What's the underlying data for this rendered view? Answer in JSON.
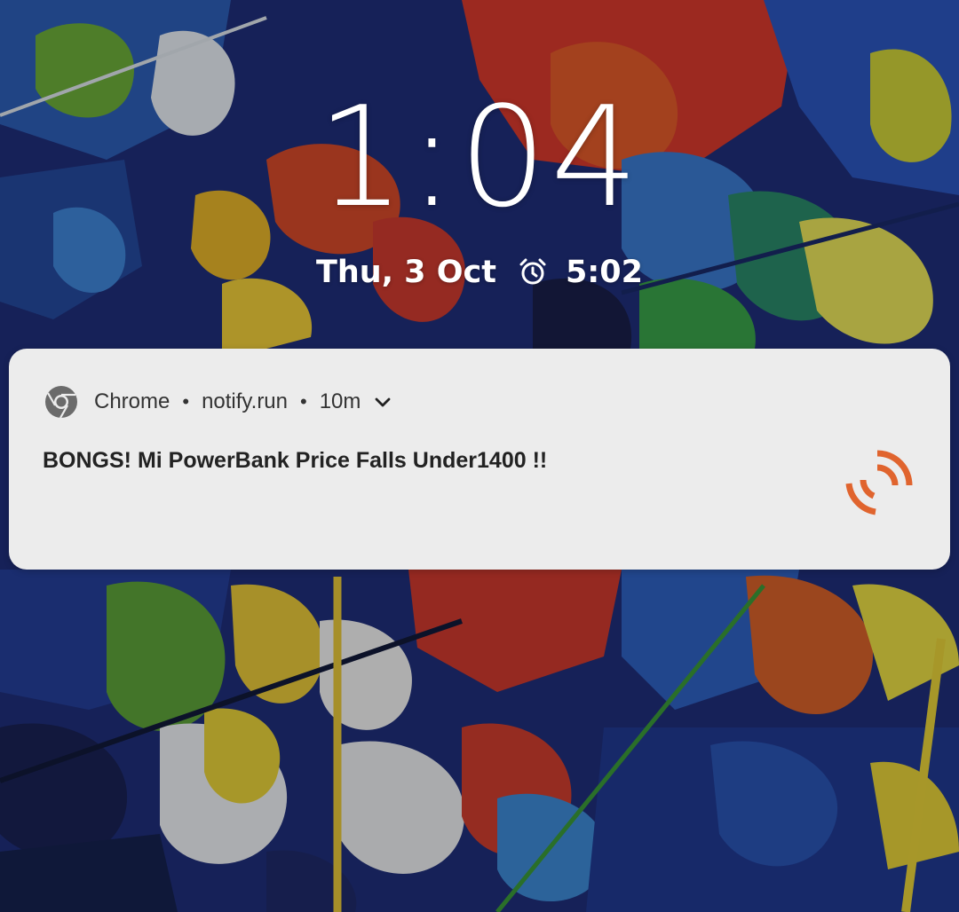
{
  "lockscreen": {
    "time": "1:04",
    "date": "Thu, 3 Oct",
    "alarm_icon": "alarm-clock-icon",
    "alarm_time": "5:02"
  },
  "notification": {
    "app_icon": "chrome-icon",
    "app_name": "Chrome",
    "source": "notify.run",
    "elapsed": "10m",
    "expand_icon": "chevron-down-icon",
    "title": "BONGS! Mi PowerBank Price Falls Under1400 !!",
    "large_icon": "notify-run-broadcast-icon",
    "accent_color": "#e0642e"
  },
  "colors": {
    "card_background": "#ececec",
    "text_primary": "#222222"
  }
}
